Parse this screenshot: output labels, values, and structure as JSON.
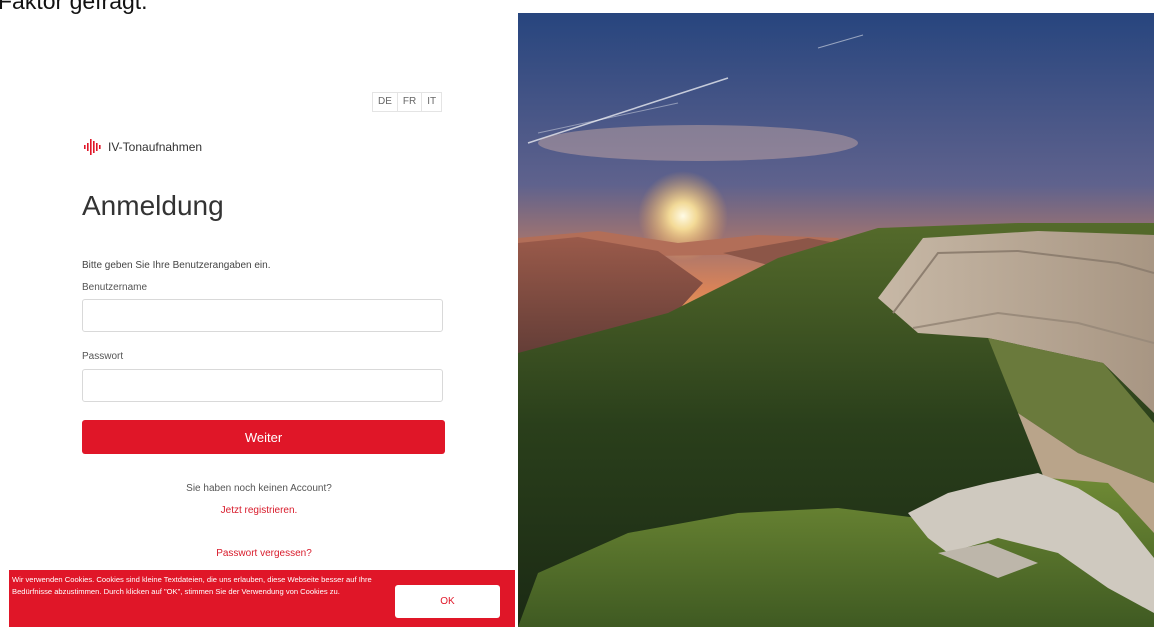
{
  "top_text": "Faktor gefragt.",
  "lang": [
    "DE",
    "FR",
    "IT"
  ],
  "logo": {
    "icon": "soundwave-icon",
    "text": "IV-Tonaufnahmen"
  },
  "title": "Anmeldung",
  "intro": "Bitte geben Sie Ihre Benutzerangaben ein.",
  "username": {
    "label": "Benutzername",
    "value": "",
    "placeholder": ""
  },
  "password": {
    "label": "Passwort",
    "value": "",
    "placeholder": ""
  },
  "submit_label": "Weiter",
  "no_account": "Sie haben noch keinen Account?",
  "register_link": "Jetzt registrieren.",
  "forgot_link": "Passwort vergessen?",
  "cookie": {
    "text": "Wir verwenden Cookies. Cookies sind kleine Textdateien, die uns erlauben, diese Webseite besser auf Ihre Bedürfnisse abzustimmen. Durch klicken auf \"OK\", stimmen Sie der Verwendung von Cookies zu.",
    "ok_label": "OK"
  },
  "colors": {
    "accent": "#e01628",
    "link": "#d81b2b"
  }
}
